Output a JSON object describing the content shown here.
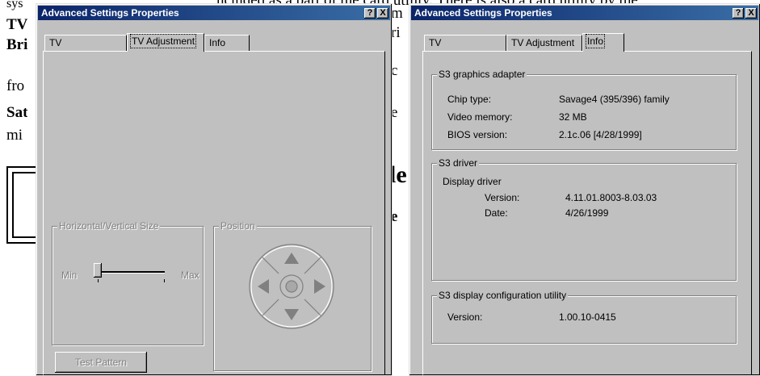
{
  "background_document": {
    "line1": "sys",
    "line2": "TV",
    "line3": "Bri",
    "line4": "fro",
    "line5": "Sat",
    "line6": "mi",
    "top_right_text": "ncluded as a part of the card utility. There is also a card utility by the",
    "mid_frag1": "m",
    "mid_frag2": "ri",
    "mid_frag3": "c",
    "mid_frag4": "e",
    "big_frag": "le",
    "frag_e": "e"
  },
  "left_dialog": {
    "title": "Advanced Settings Properties",
    "help_btn": "?",
    "close_btn": "X",
    "tabs": [
      "TV Enhancement",
      "TV Adjustment",
      "Info"
    ],
    "active_tab": "TV Adjustment",
    "size_group": {
      "legend": "Horizontal/Vertical Size",
      "min_label": "Min",
      "max_label": "Max",
      "slider_value": 0.1
    },
    "position_group": {
      "legend": "Position"
    },
    "test_pattern_button": "Test Pattern"
  },
  "right_dialog": {
    "title": "Advanced Settings Properties",
    "help_btn": "?",
    "close_btn": "X",
    "tabs": [
      "TV Enhancement",
      "TV Adjustment",
      "Info"
    ],
    "active_tab": "Info",
    "adapter_group": {
      "legend": "S3 graphics adapter",
      "rows": [
        {
          "label": "Chip type:",
          "value": "Savage4 (395/396) family"
        },
        {
          "label": "Video memory:",
          "value": "32 MB"
        },
        {
          "label": "BIOS version:",
          "value": "2.1c.06 [4/28/1999]"
        }
      ]
    },
    "driver_group": {
      "legend": "S3 driver",
      "subheading": "Display driver",
      "rows": [
        {
          "label": "Version:",
          "value": "4.11.01.8003-8.03.03"
        },
        {
          "label": "Date:",
          "value": "4/26/1999"
        }
      ]
    },
    "utility_group": {
      "legend": "S3 display configuration utility",
      "rows": [
        {
          "label": "Version:",
          "value": "1.00.10-0415"
        }
      ]
    }
  },
  "colors": {
    "titlebar_start": "#0a246a",
    "titlebar_end": "#3a6ea5",
    "face": "#c0c0c0"
  }
}
